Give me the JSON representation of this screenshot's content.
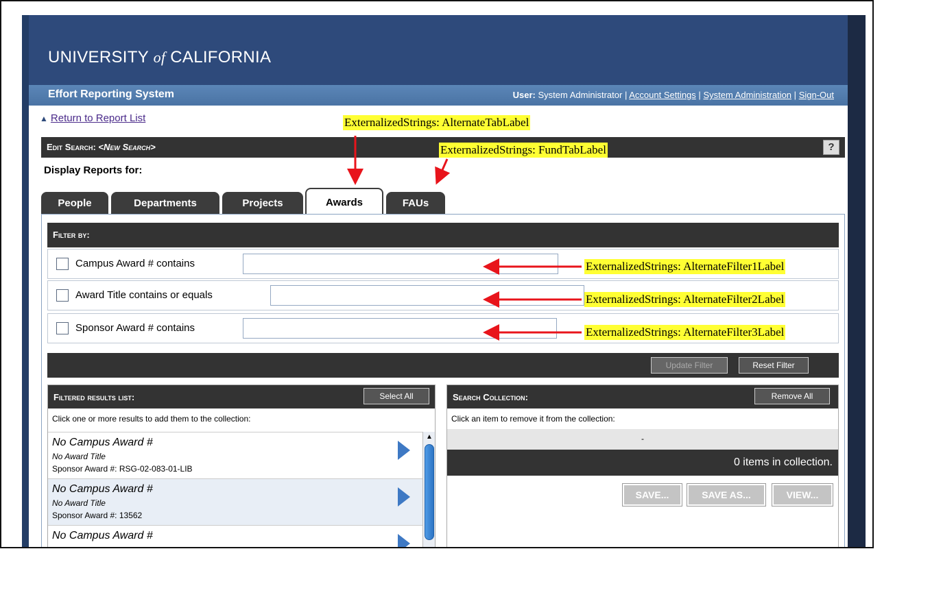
{
  "header": {
    "university_left": "UNIVERSITY",
    "university_of": "of",
    "university_right": "CALIFORNIA",
    "system_name": "Effort Reporting System",
    "user_label": "User:",
    "user_name": "System Administrator",
    "account_settings": "Account Settings",
    "system_administration": "System Administration",
    "sign_out": "Sign-Out",
    "separator": "|"
  },
  "nav": {
    "return_link": "Return to Report List",
    "return_arrow": "up-arrow-icon"
  },
  "edit_search": {
    "label": "Edit Search:",
    "search_name": "<New Search>",
    "help": "?"
  },
  "display_for": "Display Reports for:",
  "tabs": [
    {
      "label": "People",
      "active": false
    },
    {
      "label": "Departments",
      "active": false
    },
    {
      "label": "Projects",
      "active": false
    },
    {
      "label": "Awards",
      "active": true
    },
    {
      "label": "FAUs",
      "active": false
    }
  ],
  "filter": {
    "header": "Filter by:",
    "rows": [
      {
        "label": "Campus Award # contains",
        "value": "",
        "checked": false
      },
      {
        "label": "Award Title contains or equals",
        "value": "",
        "checked": false
      },
      {
        "label": "Sponsor Award # contains",
        "value": "",
        "checked": false
      }
    ],
    "update_button": "Update Filter",
    "reset_button": "Reset Filter"
  },
  "results": {
    "header": "Filtered results list:",
    "select_all": "Select All",
    "hint": "Click one or more results to add them to the collection:",
    "items": [
      {
        "title": "No Campus Award #",
        "subtitle": "No Award Title",
        "sponsor": "Sponsor Award #: RSG-02-083-01-LIB"
      },
      {
        "title": "No Campus Award #",
        "subtitle": "No Award Title",
        "sponsor": "Sponsor Award #: 13562"
      },
      {
        "title": "No Campus Award #",
        "subtitle": "",
        "sponsor": ""
      }
    ]
  },
  "collection": {
    "header": "Search Collection:",
    "remove_all": "Remove All",
    "hint": "Click an item to remove it from the collection:",
    "empty_item": "-",
    "count_text": "0 items in collection.",
    "save": "SAVE...",
    "save_as": "SAVE AS...",
    "view": "VIEW..."
  },
  "annotations": {
    "alternate_tab": "ExternalizedStrings: AlternateTabLabel",
    "fund_tab": "ExternalizedStrings: FundTabLabel",
    "filter1": "ExternalizedStrings: AlternateFilter1Label",
    "filter2": "ExternalizedStrings: AlternateFilter2Label",
    "filter3": "ExternalizedStrings: AlternateFilter3Label",
    "arrow_color": "#e8141b",
    "highlight_color": "#ffff33"
  },
  "colors": {
    "banner": "#2e4a7b",
    "subbar": "#4a73a4",
    "dark_bar": "#333333",
    "accent_blue": "#3e79c4"
  }
}
